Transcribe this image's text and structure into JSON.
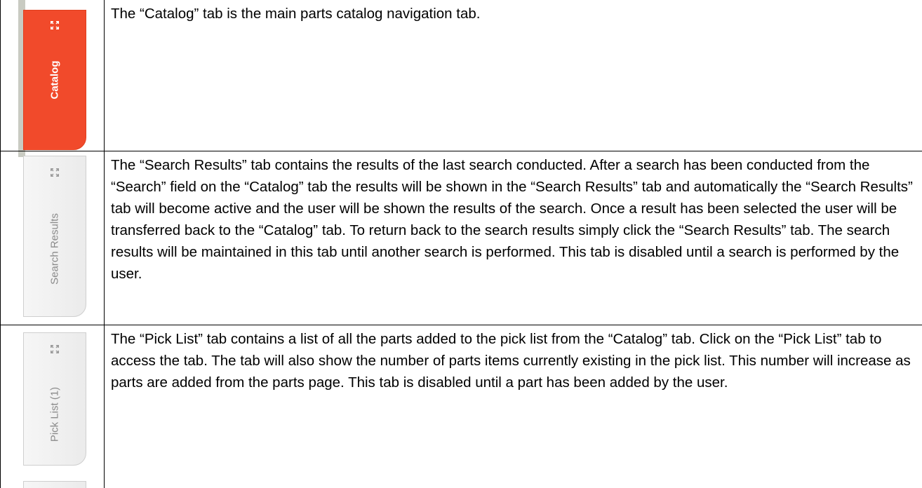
{
  "rows": [
    {
      "tab_label": "Catalog",
      "tab_state": "active",
      "description": "The “Catalog” tab is the main parts catalog navigation tab."
    },
    {
      "tab_label": "Search Results",
      "tab_state": "disabled",
      "description": "The “Search Results” tab contains the results of the last search conducted.  After a search has been conducted from the “Search” field on the “Catalog” tab the results will be shown in the “Search Results” tab and automatically the “Search Results” tab will become active and the user will be shown the results of the search.  Once a result has been selected the user will be transferred back to the “Catalog” tab.  To return back to the search results simply click the “Search Results” tab.  The search results will be maintained in this tab until another search is performed.  This tab is disabled until a search is performed by the user."
    },
    {
      "tab_label": "Pick List (1)",
      "tab_state": "disabled",
      "description": "The “Pick List” tab contains a list of all the parts added to the pick list from the “Catalog” tab.  Click on the “Pick List” tab to access the tab.  The tab will also show the number of parts items currently existing in the pick list.  This number will increase as parts are added from the parts page.  This tab is disabled until a part has been added by the user."
    }
  ],
  "colors": {
    "active_tab": "#f14a2b",
    "inactive_tab": "#f2f2f2",
    "rail": "#c9cbc2",
    "border": "#000000"
  },
  "icons": {
    "tab_icon": "expand-arrows-icon"
  }
}
